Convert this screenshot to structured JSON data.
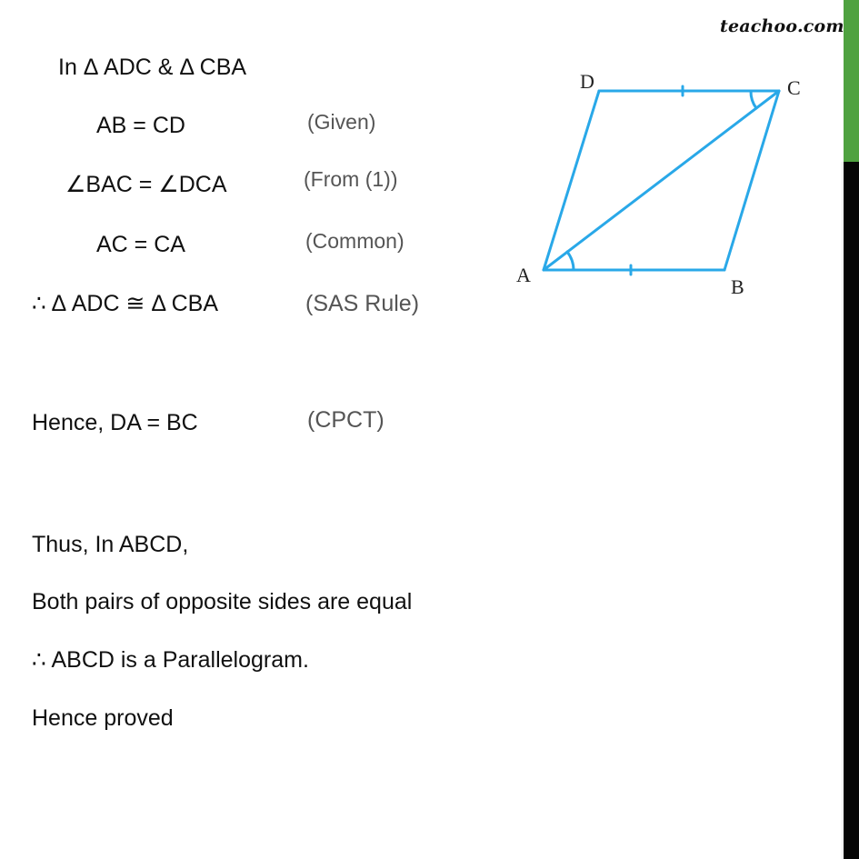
{
  "brand": {
    "name": "teachoo.com"
  },
  "proof": {
    "heading": "In Δ ADC & Δ CBA",
    "steps": [
      {
        "statement": "AB = CD",
        "reason": "(Given)"
      },
      {
        "statement": "∠BAC = ∠DCA",
        "reason": "(From (1))"
      },
      {
        "statement": "AC = CA",
        "reason": "(Common)"
      },
      {
        "statement": "∴ Δ ADC ≅ Δ CBA",
        "reason": "(SAS Rule)"
      }
    ],
    "result": {
      "statement": "Hence,  DA = BC",
      "reason": "(CPCT)"
    },
    "conclusion": [
      "Thus, In ABCD,",
      "Both pairs of opposite sides are equal",
      "∴ ABCD is a Parallelogram.",
      "Hence proved"
    ]
  },
  "diagram": {
    "vertices": [
      "A",
      "B",
      "C",
      "D"
    ],
    "line_color": "#29a8e8",
    "segments": [
      "AB",
      "BC",
      "CD",
      "DA",
      "AC"
    ],
    "equal_marks": [
      "AB",
      "DC"
    ],
    "angle_marks": [
      "BAC",
      "DCA"
    ]
  },
  "scrollbar": {
    "thumb_color": "#4fa240",
    "track_color": "#050505"
  }
}
